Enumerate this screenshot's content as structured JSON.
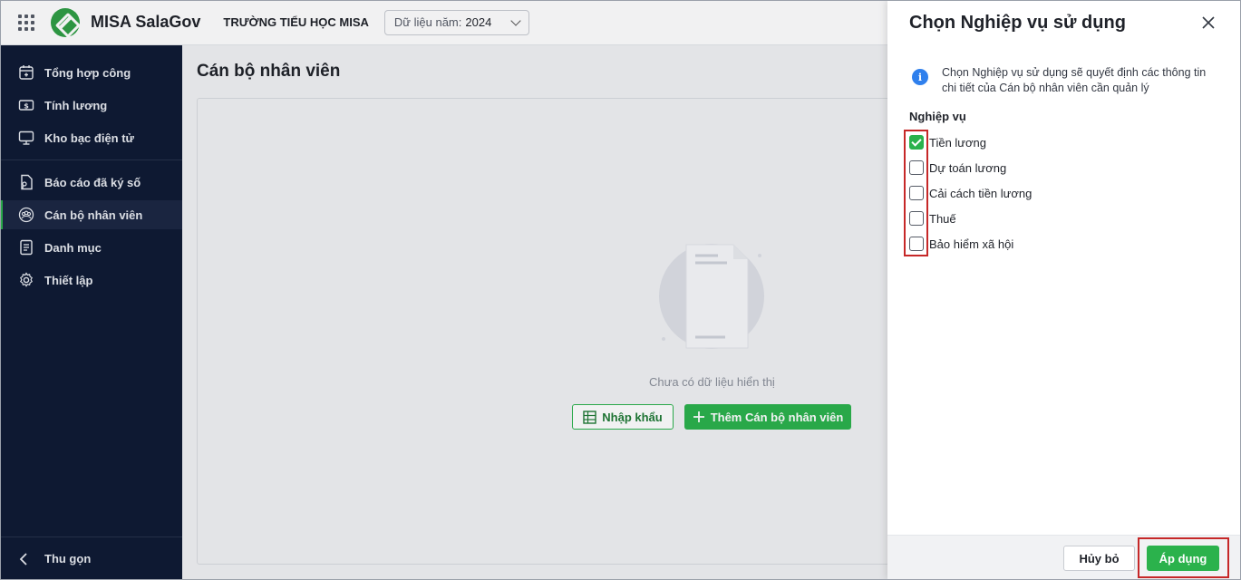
{
  "header": {
    "app_name": "MISA SalaGov",
    "school": "TRƯỜNG TIỂU HỌC MISA",
    "year_label": "Dữ liệu năm:",
    "year_value": "2024"
  },
  "sidebar": {
    "items": [
      {
        "label": "Tổng hợp công",
        "icon": "calendar-icon"
      },
      {
        "label": "Tính lương",
        "icon": "money-icon"
      },
      {
        "label": "Kho bạc điện tử",
        "icon": "monitor-icon"
      },
      {
        "label": "Báo cáo đã ký số",
        "icon": "signed-report-icon"
      },
      {
        "label": "Cán bộ nhân viên",
        "icon": "staff-icon",
        "active": true
      },
      {
        "label": "Danh mục",
        "icon": "catalog-icon"
      },
      {
        "label": "Thiết lập",
        "icon": "gear-icon"
      }
    ],
    "collapse_label": "Thu gọn"
  },
  "main": {
    "title": "Cán bộ nhân viên",
    "empty_text": "Chưa có dữ liệu hiển thị",
    "import_label": "Nhập khẩu",
    "add_label": "Thêm Cán bộ nhân viên"
  },
  "panel": {
    "title": "Chọn Nghiệp vụ sử dụng",
    "info_text": "Chọn Nghiệp vụ sử dụng sẽ quyết định các thông tin chi tiết của Cán bộ nhân viên cần quản lý",
    "group_label": "Nghiệp vụ",
    "options": [
      {
        "label": "Tiền lương",
        "checked": true
      },
      {
        "label": "Dự toán lương",
        "checked": false
      },
      {
        "label": "Cải cách tiền lương",
        "checked": false
      },
      {
        "label": "Thuế",
        "checked": false
      },
      {
        "label": "Bảo hiểm xã hội",
        "checked": false
      }
    ],
    "cancel_label": "Hủy bỏ",
    "apply_label": "Áp dụng"
  },
  "colors": {
    "brand_green": "#2bb24c",
    "sidebar_bg": "#0e1a33",
    "highlight_red": "#c62828",
    "info_blue": "#2f80ed"
  }
}
